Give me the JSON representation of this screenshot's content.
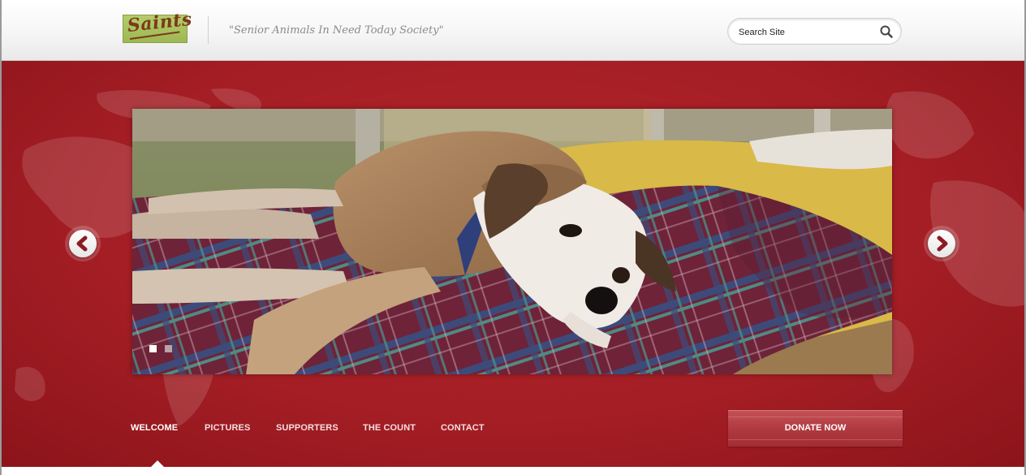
{
  "header": {
    "logo_text": "Saints",
    "tagline": "\"Senior Animals In Need Today Society\"",
    "search": {
      "placeholder": "Search Site",
      "icon": "search-icon"
    }
  },
  "slider": {
    "photo_description_icon": "dog-photo",
    "prev_icon": "chevron-left-icon",
    "next_icon": "chevron-right-icon",
    "dots": 2,
    "active_dot": 1
  },
  "nav": {
    "items": [
      {
        "label": "WELCOME",
        "active": true
      },
      {
        "label": "PICTURES",
        "active": false
      },
      {
        "label": "SUPPORTERS",
        "active": false
      },
      {
        "label": "THE COUNT",
        "active": false
      },
      {
        "label": "CONTACT",
        "active": false
      }
    ],
    "donate_label": "DONATE NOW"
  },
  "colors": {
    "band_red": "#a51e25",
    "logo_green": "#a8c05c",
    "logo_text": "#7a3a1a",
    "donate": "#b13a40"
  }
}
